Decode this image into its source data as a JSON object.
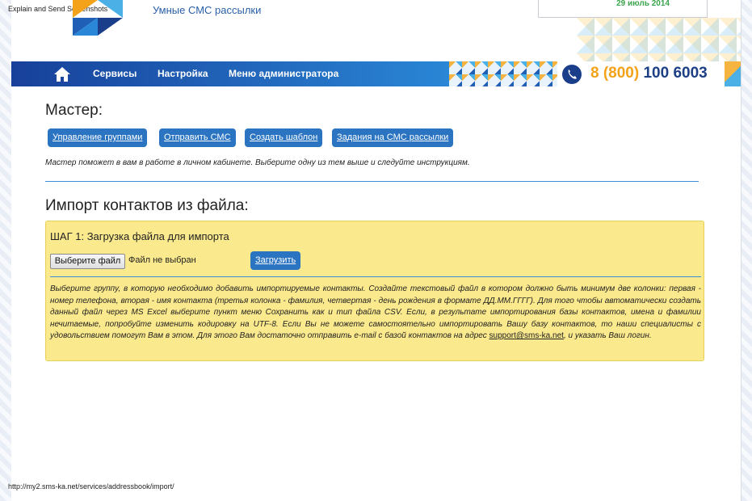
{
  "extension_label": "Explain and Send Screenshots",
  "header": {
    "tagline": "Умные СМС рассылки",
    "date": "29 июль 2014"
  },
  "nav": {
    "items": [
      "Сервисы",
      "Настройка",
      "Меню администратора"
    ],
    "phone_code": "8 (800)",
    "phone_number": "100 6003"
  },
  "wizard": {
    "title": "Мастер:",
    "buttons": [
      "Управление группами",
      "Отправить СМС",
      "Создать шаблон",
      "Задания на СМС рассылки"
    ],
    "hint": "Мастер поможет в вам в работе в личном кабинете. Выберите одну из тем выше и следуйте инструкциям."
  },
  "import": {
    "title": "Импорт контактов из файла:",
    "step_title": "ШАГ 1: Загрузка файла для импорта",
    "file_button": "Выберите файл",
    "file_status": "Файл не выбран",
    "upload_button": "Загрузить",
    "description": "Выберите группу, в которую необходимо добавить импортируемые контакты. Создайте текстовый файл в котором должно быть минимум две колонки: первая - номер телефона, вторая - имя контакта (третья колонка - фамилия, четвертая - день рождения в формате ДД.ММ.ГГГГ). Для того чтобы автоматически создать данный файл через MS Excel выберите пункт меню Сохранить как и тип файла CSV. Если, в результате импортирования базы контактов, имена и фамилии нечитаемые, попробуйте изменить кодировку на UTF-8. Если Вы не можете самостоятельно импортировать Вашу базу контактов, то наши специалисты с удовольствием помогут Вам в этом. Для этого Вам достаточно отправить e-mail с базой контактов на адрес",
    "email": "support@sms-ka.net",
    "description_end": ", и указать Ваш логин."
  },
  "status_url": "http://my2.sms-ka.net/services/addressbook/import/",
  "colors": {
    "nav_blue": "#1f5fb6",
    "button_blue": "#2a74c2",
    "panel_yellow": "#fbe98d",
    "phone_orange": "#f3a21a",
    "date_green": "#3aa54b"
  }
}
